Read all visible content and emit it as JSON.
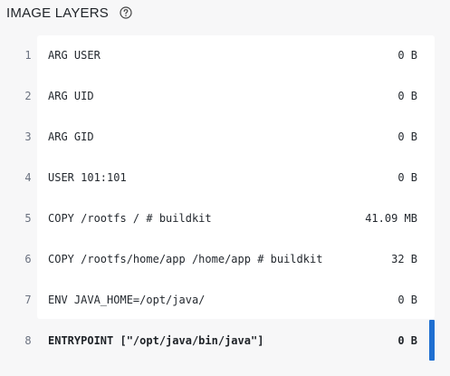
{
  "header": {
    "title": "IMAGE LAYERS",
    "help_icon": "question-circle-icon"
  },
  "layers": [
    {
      "index": "1",
      "command": "ARG USER",
      "size": "0 B"
    },
    {
      "index": "2",
      "command": "ARG UID",
      "size": "0 B"
    },
    {
      "index": "3",
      "command": "ARG GID",
      "size": "0 B"
    },
    {
      "index": "4",
      "command": "USER 101:101",
      "size": "0 B"
    },
    {
      "index": "5",
      "command": "COPY /rootfs / # buildkit",
      "size": "41.09 MB"
    },
    {
      "index": "6",
      "command": "COPY /rootfs/home/app /home/app # buildkit",
      "size": "32 B"
    },
    {
      "index": "7",
      "command": "ENV JAVA_HOME=/opt/java/",
      "size": "0 B"
    },
    {
      "index": "8",
      "command": "ENTRYPOINT [\"/opt/java/bin/java\"]",
      "size": "0 B"
    }
  ],
  "selected_layer": "8",
  "colors": {
    "accent": "#1f6fd1",
    "card_background": "#ffffff",
    "panel_background": "#f7f7f8"
  }
}
